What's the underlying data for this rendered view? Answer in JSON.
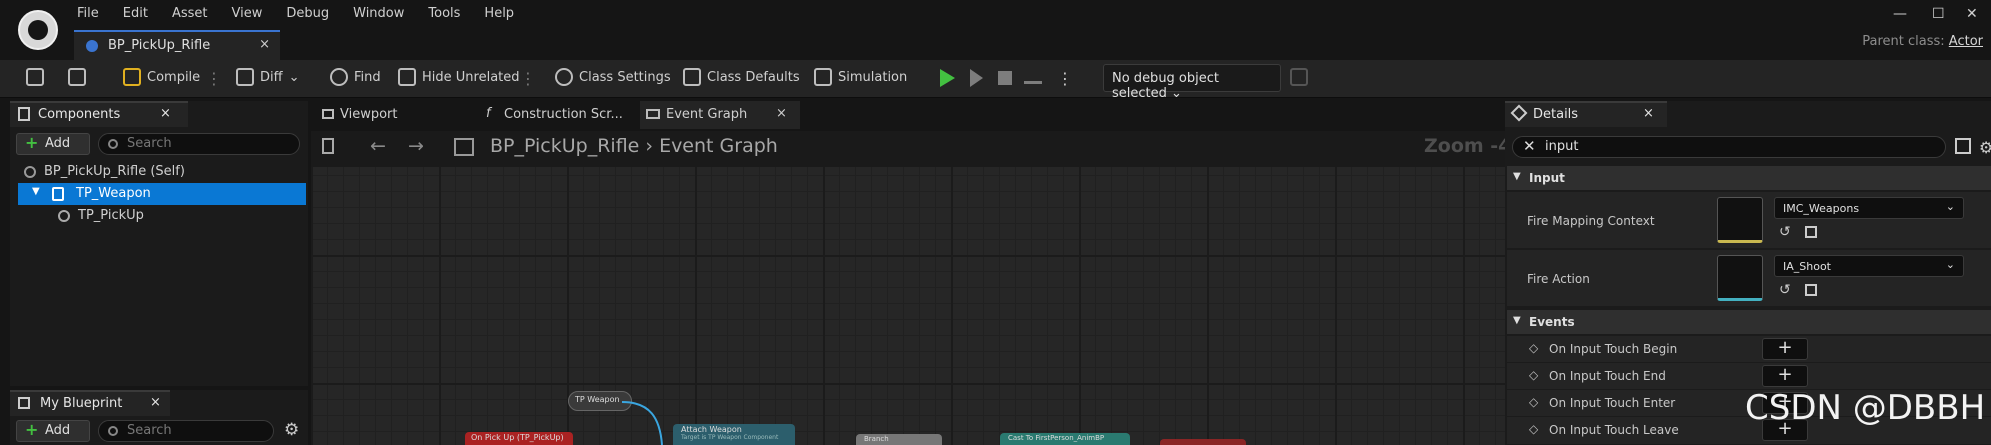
{
  "menu": [
    "File",
    "Edit",
    "Asset",
    "View",
    "Debug",
    "Window",
    "Tools",
    "Help"
  ],
  "document_tab": {
    "title": "BP_PickUp_Rifle",
    "close": "×"
  },
  "parent_class": {
    "label": "Parent class:",
    "value": "Actor"
  },
  "toolbar": {
    "compile": "Compile",
    "diff": "Diff",
    "find": "Find",
    "hide_unrelated": "Hide Unrelated",
    "class_settings": "Class Settings",
    "class_defaults": "Class Defaults",
    "simulation": "Simulation",
    "debug_object": "No debug object selected"
  },
  "components_panel": {
    "title": "Components",
    "add_label": "Add",
    "search_placeholder": "Search",
    "tree": [
      "BP_PickUp_Rifle (Self)",
      "TP_Weapon",
      "TP_PickUp"
    ],
    "selected": "TP_Weapon"
  },
  "my_blueprint_panel": {
    "title": "My Blueprint",
    "add_label": "Add",
    "search_placeholder": "Search"
  },
  "graph_tabs": [
    "Viewport",
    "Construction Scr...",
    "Event Graph"
  ],
  "active_graph_tab": "Event Graph",
  "breadcrumb": {
    "blueprint": "BP_PickUp_Rifle",
    "graph": "Event Graph"
  },
  "zoom": "Zoom -4",
  "graph_nodes": {
    "tp_weapon": "TP Weapon",
    "on_pickup": "On Pick Up (TP_PickUp)",
    "attach_weapon": "Attach Weapon",
    "attach_sub": "Target is TP Weapon Component",
    "branch": "Branch",
    "cast": "Cast To FirstPerson_AnimBP"
  },
  "details_panel": {
    "title": "Details",
    "search_value": "input",
    "categories": {
      "input": "Input",
      "events": "Events"
    },
    "properties": [
      {
        "label": "Fire Mapping Context",
        "value": "IMC_Weapons"
      },
      {
        "label": "Fire Action",
        "value": "IA_Shoot"
      }
    ],
    "events": [
      "On Input Touch Begin",
      "On Input Touch End",
      "On Input Touch Enter",
      "On Input Touch Leave"
    ]
  },
  "watermark": "CSDN @DBBH"
}
